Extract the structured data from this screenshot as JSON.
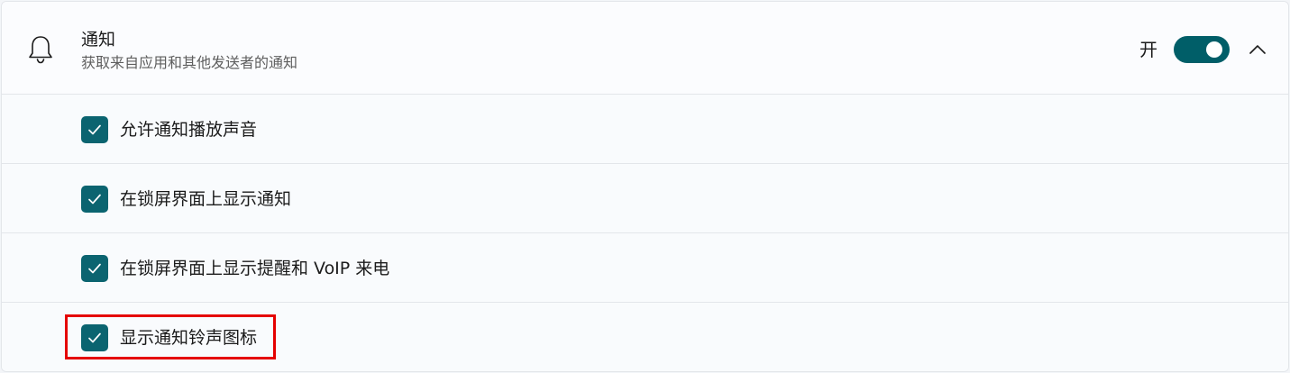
{
  "notifications": {
    "title": "通知",
    "subtitle": "获取来自应用和其他发送者的通知",
    "toggle_state_label": "开",
    "toggle_on": true,
    "icon": "bell-icon",
    "expand_icon": "chevron-up-icon"
  },
  "options": [
    {
      "label": "允许通知播放声音",
      "checked": true
    },
    {
      "label": "在锁屏界面上显示通知",
      "checked": true
    },
    {
      "label": "在锁屏界面上显示提醒和 VoIP 来电",
      "checked": true
    },
    {
      "label": "显示通知铃声图标",
      "checked": true
    }
  ],
  "colors": {
    "accent": "#005e68",
    "highlight": "#e50000"
  }
}
